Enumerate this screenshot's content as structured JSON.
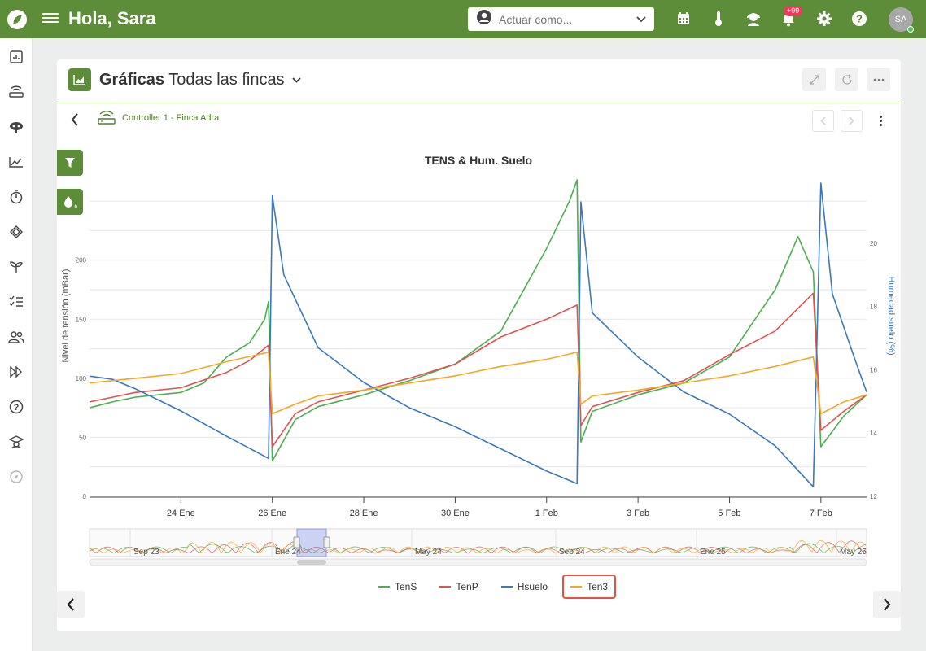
{
  "topbar": {
    "greeting": "Hola, Sara",
    "act_as_placeholder": "Actuar como...",
    "notification_count": "+99",
    "avatar_initials": "SA",
    "brand_color": "#5d8d38"
  },
  "sidebar": {
    "items": [
      {
        "icon": "dashboard-icon"
      },
      {
        "icon": "controller-icon"
      },
      {
        "icon": "sensor-icon"
      },
      {
        "icon": "charts-icon"
      },
      {
        "icon": "timer-icon"
      },
      {
        "icon": "layers-icon"
      },
      {
        "icon": "sprout-icon"
      },
      {
        "icon": "tasks-icon"
      },
      {
        "icon": "users-icon"
      },
      {
        "icon": "forward-icon"
      },
      {
        "icon": "help-icon"
      },
      {
        "icon": "academy-icon"
      },
      {
        "icon": "compass-icon"
      }
    ]
  },
  "card": {
    "title_bold": "Gráficas",
    "title_rest": "Todas las fincas",
    "controller_label": "Controller 1 - Finca Adra"
  },
  "chart_data": {
    "type": "line",
    "title": "TENS & Hum. Suelo",
    "ylabel": "Nivel de tensión (mBar)",
    "y2label": "Humedad suelo (%)",
    "x_type": "date",
    "xlim": [
      "2024-01-22",
      "2024-02-08"
    ],
    "ylim": [
      0,
      268
    ],
    "y2lim": [
      12,
      22
    ],
    "yticks": [
      0,
      50,
      100,
      150,
      200
    ],
    "y2ticks": [
      12,
      14,
      16,
      18,
      20
    ],
    "xtick_labels": [
      "24 Ene",
      "26 Ene",
      "28 Ene",
      "30 Ene",
      "1 Feb",
      "3 Feb",
      "5 Feb",
      "7 Feb"
    ],
    "xtick_dates": [
      "2024-01-24",
      "2024-01-26",
      "2024-01-28",
      "2024-01-30",
      "2024-02-01",
      "2024-02-03",
      "2024-02-05",
      "2024-02-07"
    ],
    "grid": true,
    "legend_position": "bottom-center",
    "series": [
      {
        "name": "TenS",
        "color": "#4caf50",
        "axis": "left",
        "points": [
          [
            "2024-01-22",
            75
          ],
          [
            "2024-01-22 12:00",
            80
          ],
          [
            "2024-01-23",
            84
          ],
          [
            "2024-01-24",
            88
          ],
          [
            "2024-01-24 12:00",
            96
          ],
          [
            "2024-01-25",
            118
          ],
          [
            "2024-01-25 12:00",
            130
          ],
          [
            "2024-01-25 20:00",
            150
          ],
          [
            "2024-01-25 22:00",
            165
          ],
          [
            "2024-01-26",
            30
          ],
          [
            "2024-01-26 12:00",
            65
          ],
          [
            "2024-01-27",
            76
          ],
          [
            "2024-01-28",
            86
          ],
          [
            "2024-01-29",
            98
          ],
          [
            "2024-01-30",
            112
          ],
          [
            "2024-01-31",
            140
          ],
          [
            "2024-02-01",
            210
          ],
          [
            "2024-02-01 12:00",
            250
          ],
          [
            "2024-02-01 16:00",
            268
          ],
          [
            "2024-02-01 18:00",
            46
          ],
          [
            "2024-02-02",
            72
          ],
          [
            "2024-02-03",
            86
          ],
          [
            "2024-02-04",
            96
          ],
          [
            "2024-02-05",
            118
          ],
          [
            "2024-02-06",
            175
          ],
          [
            "2024-02-06 12:00",
            220
          ],
          [
            "2024-02-06 20:00",
            190
          ],
          [
            "2024-02-07",
            42
          ],
          [
            "2024-02-07 12:00",
            68
          ],
          [
            "2024-02-08",
            86
          ]
        ]
      },
      {
        "name": "TenP",
        "color": "#e05252",
        "axis": "left",
        "points": [
          [
            "2024-01-22",
            80
          ],
          [
            "2024-01-22 12:00",
            84
          ],
          [
            "2024-01-23",
            88
          ],
          [
            "2024-01-24",
            92
          ],
          [
            "2024-01-25",
            105
          ],
          [
            "2024-01-25 12:00",
            115
          ],
          [
            "2024-01-25 22:00",
            128
          ],
          [
            "2024-01-26",
            42
          ],
          [
            "2024-01-26 12:00",
            70
          ],
          [
            "2024-01-27",
            80
          ],
          [
            "2024-01-28",
            90
          ],
          [
            "2024-01-29",
            100
          ],
          [
            "2024-01-30",
            112
          ],
          [
            "2024-01-31",
            135
          ],
          [
            "2024-02-01",
            150
          ],
          [
            "2024-02-01 16:00",
            162
          ],
          [
            "2024-02-01 18:00",
            60
          ],
          [
            "2024-02-02",
            76
          ],
          [
            "2024-02-03",
            88
          ],
          [
            "2024-02-04",
            98
          ],
          [
            "2024-02-05",
            120
          ],
          [
            "2024-02-06",
            140
          ],
          [
            "2024-02-06 20:00",
            172
          ],
          [
            "2024-02-07",
            56
          ],
          [
            "2024-02-07 12:00",
            72
          ],
          [
            "2024-02-08",
            86
          ]
        ]
      },
      {
        "name": "Hsuelo",
        "color": "#3a78c0",
        "axis": "right",
        "points": [
          [
            "2024-01-22",
            15.8
          ],
          [
            "2024-01-22 12:00",
            15.7
          ],
          [
            "2024-01-23",
            15.4
          ],
          [
            "2024-01-24",
            14.7
          ],
          [
            "2024-01-25",
            13.9
          ],
          [
            "2024-01-25 22:00",
            13.2
          ],
          [
            "2024-01-26",
            21.5
          ],
          [
            "2024-01-26 06:00",
            19.0
          ],
          [
            "2024-01-27",
            16.7
          ],
          [
            "2024-01-28",
            15.6
          ],
          [
            "2024-01-29",
            14.8
          ],
          [
            "2024-01-30",
            14.2
          ],
          [
            "2024-01-31",
            13.5
          ],
          [
            "2024-02-01",
            12.8
          ],
          [
            "2024-02-01 16:00",
            12.4
          ],
          [
            "2024-02-01 18:00",
            21.3
          ],
          [
            "2024-02-02",
            17.8
          ],
          [
            "2024-02-03",
            16.4
          ],
          [
            "2024-02-04",
            15.3
          ],
          [
            "2024-02-05",
            14.6
          ],
          [
            "2024-02-06",
            13.6
          ],
          [
            "2024-02-06 20:00",
            12.3
          ],
          [
            "2024-02-07",
            21.9
          ],
          [
            "2024-02-07 06:00",
            18.4
          ],
          [
            "2024-02-07 18:00",
            16.3
          ],
          [
            "2024-02-08",
            15.3
          ]
        ]
      },
      {
        "name": "Ten3",
        "color": "#f5a623",
        "axis": "left",
        "points": [
          [
            "2024-01-22",
            96
          ],
          [
            "2024-01-23",
            100
          ],
          [
            "2024-01-24",
            104
          ],
          [
            "2024-01-25",
            114
          ],
          [
            "2024-01-25 22:00",
            122
          ],
          [
            "2024-01-26",
            70
          ],
          [
            "2024-01-26 12:00",
            78
          ],
          [
            "2024-01-27",
            85
          ],
          [
            "2024-01-28",
            90
          ],
          [
            "2024-01-29",
            96
          ],
          [
            "2024-01-30",
            102
          ],
          [
            "2024-01-31",
            110
          ],
          [
            "2024-02-01",
            116
          ],
          [
            "2024-02-01 16:00",
            122
          ],
          [
            "2024-02-01 18:00",
            78
          ],
          [
            "2024-02-02",
            85
          ],
          [
            "2024-02-03",
            90
          ],
          [
            "2024-02-04",
            96
          ],
          [
            "2024-02-05",
            102
          ],
          [
            "2024-02-06",
            110
          ],
          [
            "2024-02-06 20:00",
            118
          ],
          [
            "2024-02-07",
            70
          ],
          [
            "2024-02-07 12:00",
            80
          ],
          [
            "2024-02-08",
            86
          ]
        ]
      }
    ],
    "navigator": {
      "labels": [
        "Sep 23",
        "Ene 24",
        "May 24",
        "Sep 24",
        "Ene 25",
        "May 25"
      ]
    }
  },
  "legend": {
    "items": [
      {
        "label": "TenS",
        "color": "#4caf50"
      },
      {
        "label": "TenP",
        "color": "#e05252"
      },
      {
        "label": "Hsuelo",
        "color": "#3a78c0"
      },
      {
        "label": "Ten3",
        "color": "#f5a623"
      }
    ]
  }
}
